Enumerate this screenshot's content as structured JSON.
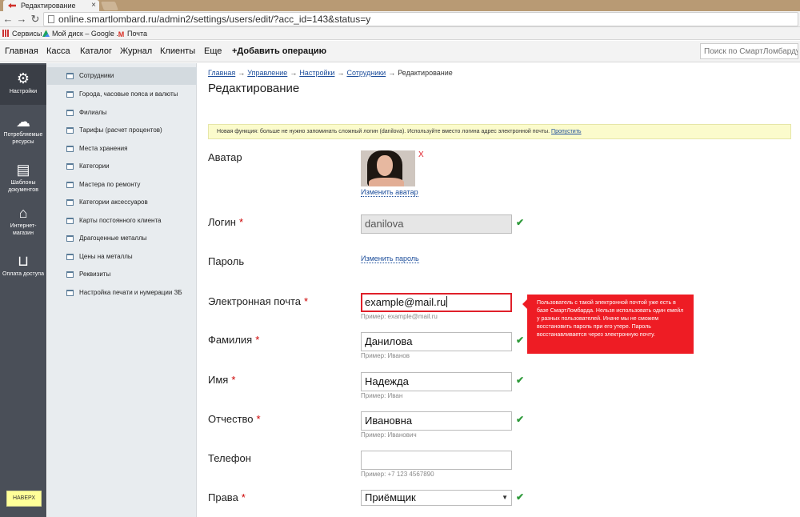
{
  "browser": {
    "tab_title": "Редактирование",
    "tab_close": "×",
    "url": "online.smartlombard.ru/admin2/settings/users/edit/?acc_id=143&status=y",
    "bookmarks": [
      {
        "label": "Сервисы",
        "icon": "apps-icon"
      },
      {
        "label": "Мой диск – Google ...",
        "icon": "google-drive-icon"
      },
      {
        "label": "Почта",
        "icon": "gmail-icon"
      }
    ]
  },
  "topnav": {
    "items": [
      "Главная",
      "Касса",
      "Каталог",
      "Журнал",
      "Клиенты",
      "Еще"
    ],
    "add_operation": "+Добавить операцию",
    "search_placeholder": "Поиск по СмартЛомбарду"
  },
  "rail": {
    "items": [
      {
        "label": "Настройки",
        "icon": "gear-icon",
        "active": true
      },
      {
        "label": "Потребляемые ресурсы",
        "icon": "cloud-icon"
      },
      {
        "label": "Шаблоны документов",
        "icon": "document-icon"
      },
      {
        "label": "Интернет-магазин",
        "icon": "home-icon"
      },
      {
        "label": "Оплата доступа",
        "icon": "basket-icon"
      }
    ],
    "up_button": "НАВЕРХ"
  },
  "submenu": {
    "items": [
      "Сотрудники",
      "Города, часовые пояса и валюты",
      "Филиалы",
      "Тарифы (расчет процентов)",
      "Места хранения",
      "Категории",
      "Мастера по ремонту",
      "Категории аксессуаров",
      "Карты постоянного клиента",
      "Драгоценные металлы",
      "Цены на металлы",
      "Реквизиты",
      "Настройка печати и нумерации ЗБ"
    ],
    "active_index": 0
  },
  "breadcrumbs": {
    "links": [
      "Главная",
      "Управление",
      "Настройки",
      "Сотрудники"
    ],
    "current": "Редактирование",
    "separator": "→"
  },
  "page_title": "Редактирование",
  "notice": {
    "text": "Новая функция: больше не нужно запоминать сложный логин (danilova). Используйте вместо логина адрес электронной почты.",
    "link": "Пропустить"
  },
  "form": {
    "avatar": {
      "label": "Аватар",
      "change_link": "Изменить аватар",
      "remove": "X"
    },
    "login": {
      "label": "Логин",
      "required_mark": "*",
      "value": "danilova"
    },
    "password": {
      "label": "Пароль",
      "change_link": "Изменить пароль"
    },
    "email": {
      "label": "Электронная почта",
      "required_mark": "*",
      "value": "example@mail.ru",
      "hint": "Пример: example@mail.ru"
    },
    "lastname": {
      "label": "Фамилия",
      "required_mark": "*",
      "value": "Данилова",
      "hint": "Пример: Иванов"
    },
    "firstname": {
      "label": "Имя",
      "required_mark": "*",
      "value": "Надежда",
      "hint": "Пример: Иван"
    },
    "patronymic": {
      "label": "Отчество",
      "required_mark": "*",
      "value": "Ивановна",
      "hint": "Пример: Иванович"
    },
    "phone": {
      "label": "Телефон",
      "value": "",
      "hint": "Пример: +7 123 4567890"
    },
    "rights": {
      "label": "Права",
      "required_mark": "*",
      "value": "Приёмщик"
    },
    "check_mark": "✔"
  },
  "email_error": "Пользователь с такой электронной почтой уже есть в базе СмартЛомбарда. Нельзя использовать один емейл у разных пользователей. Иначе мы не сможем восстановить пароль при его утере. Пароль восстанавливается через электронную почту.",
  "colors": {
    "accent_link": "#1d4e9b",
    "error": "#ee1c24",
    "valid": "#2e9a3a",
    "rail_bg": "#4a4f58",
    "notice_bg": "#fbfbcc"
  }
}
